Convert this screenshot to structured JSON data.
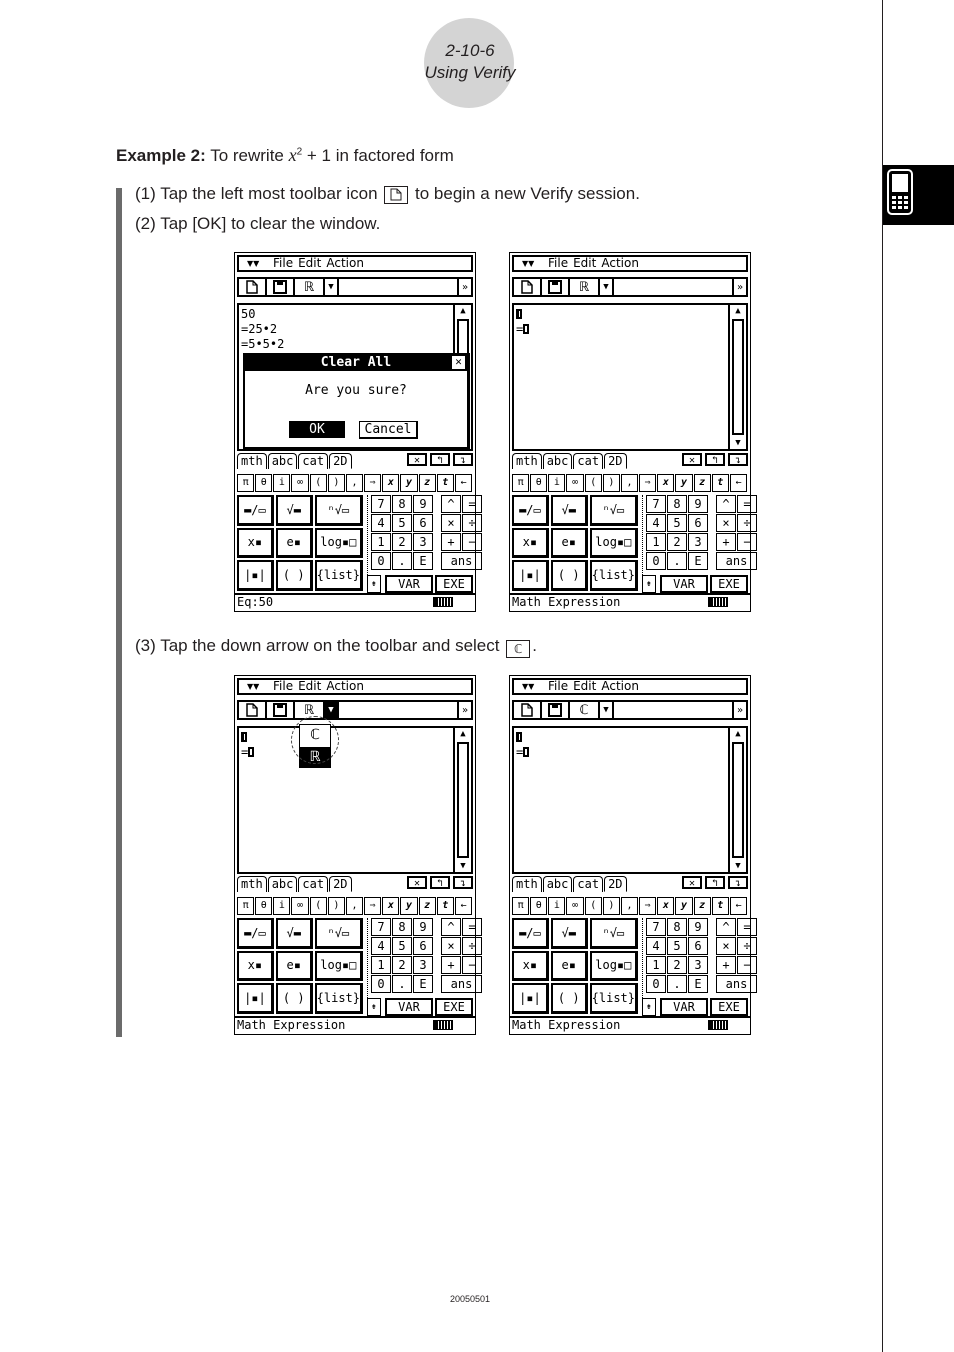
{
  "header": {
    "section": "2-10-6",
    "title": "Using Verify"
  },
  "example": {
    "label": "Example 2:",
    "text_before": "To rewrite ",
    "var": "x",
    "exp": "2",
    "text_after": " + 1 in factored form"
  },
  "steps": [
    {
      "num": "(1)",
      "before": "Tap the left most toolbar icon",
      "icon": "new-file-icon",
      "after": "to begin a new Verify session."
    },
    {
      "num": "(2)",
      "text": "Tap [OK] to clear the window."
    },
    {
      "num": "(3)",
      "before": "Tap the down arrow on the toolbar and select",
      "icon_glyph": "ℂ",
      "after": "."
    }
  ],
  "footer": {
    "code": "20050501"
  },
  "calc": {
    "menu": {
      "items": [
        "File",
        "Edit",
        "Action"
      ]
    },
    "toolbar": {
      "real_glyph": "ℝ",
      "complex_glyph": "ℂ",
      "dropdown_glyph": "▼",
      "more_glyph": "»"
    },
    "tabs": [
      "mth",
      "abc",
      "cat",
      "2D"
    ],
    "tab_buttons": [
      "✕",
      "↰",
      "↴"
    ],
    "symbols": [
      "π",
      "θ",
      "i",
      "∞",
      "(",
      ")",
      ",",
      "⇒",
      "x",
      "y",
      "z",
      "t",
      "←"
    ],
    "templates": [
      "▬/▭",
      "√▬",
      "ⁿ√▭",
      "x▪",
      "e▪",
      "log▪□",
      "|▪|",
      "( )",
      "{list}"
    ],
    "keys": [
      [
        "7",
        "8",
        "9",
        "",
        "^",
        "="
      ],
      [
        "4",
        "5",
        "6",
        "",
        "×",
        "÷"
      ],
      [
        "1",
        "2",
        "3",
        "",
        "+",
        "−"
      ],
      [
        "0",
        ".",
        "E",
        "",
        "ans"
      ]
    ],
    "var_label": "VAR",
    "exe_label": "EXE",
    "screens": [
      {
        "work_lines": [
          "50",
          "=25•2",
          "=5•5•2"
        ],
        "dialog": {
          "title": "Clear All",
          "message": "Are you sure?",
          "ok": "OK",
          "cancel": "Cancel"
        },
        "status": "Eq:50"
      },
      {
        "work_lines": [
          "▯",
          "=▯"
        ],
        "status": "Math Expression"
      },
      {
        "work_lines": [
          "▯",
          "=▯"
        ],
        "dropdown": {
          "selected": "ℂ",
          "other": "ℝ"
        },
        "status": "Math Expression"
      },
      {
        "work_lines": [
          "▯",
          "=▯"
        ],
        "status": "Math Expression"
      }
    ]
  }
}
